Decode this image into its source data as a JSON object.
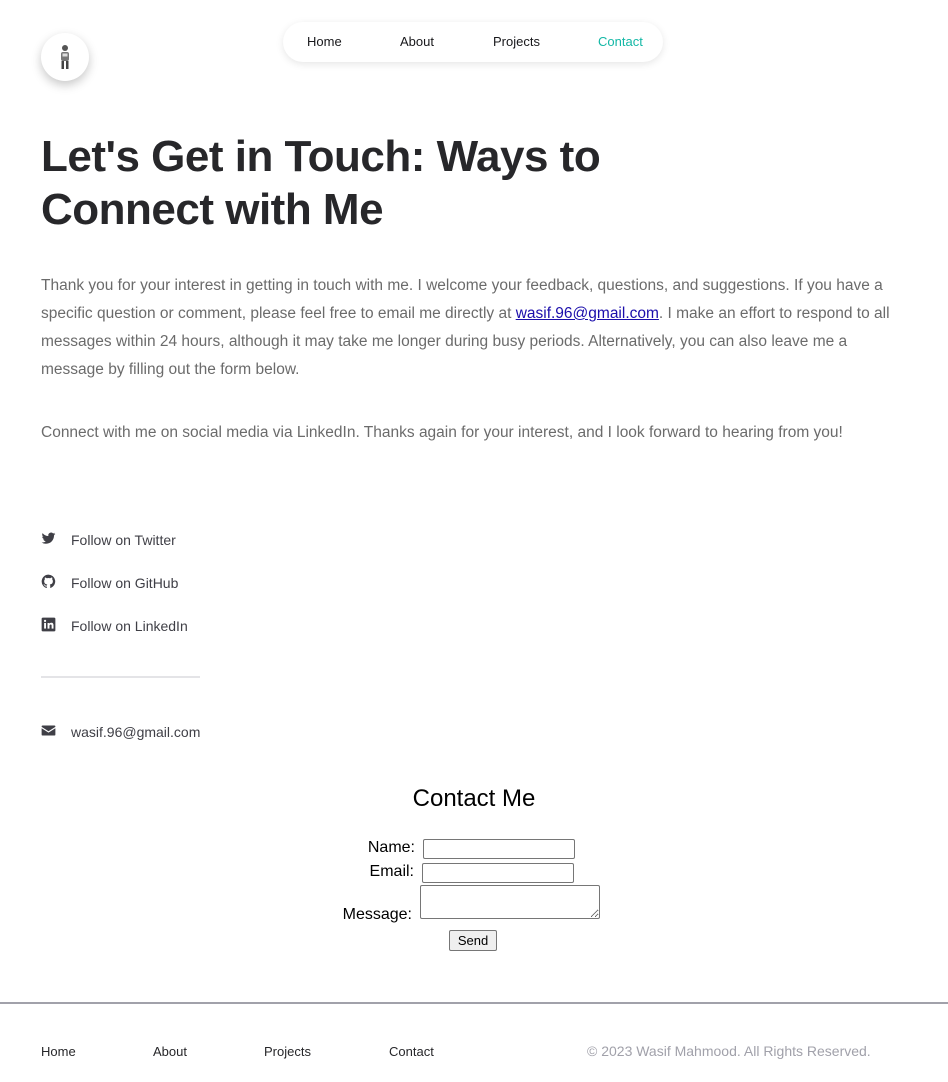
{
  "header": {
    "nav": [
      {
        "label": "Home",
        "active": false
      },
      {
        "label": "About",
        "active": false
      },
      {
        "label": "Projects",
        "active": false
      },
      {
        "label": "Contact",
        "active": true
      }
    ],
    "accent_color": "#14b8a6"
  },
  "main": {
    "title": "Let's Get in Touch: Ways to Connect with Me",
    "intro": {
      "before_email": "Thank you for your interest in getting in touch with me. I welcome your feedback, questions, and suggestions. If you have a specific question or comment, please feel free to email me directly at ",
      "email_link": "wasif.96@gmail.com",
      "after_email": ". I make an effort to respond to all messages within 24 hours, although it may take me longer during busy periods. Alternatively, you can also leave me a message by filling out the form below."
    },
    "social_note": "Connect with me on social media via LinkedIn. Thanks again for your interest, and I look forward to hearing from you!",
    "social_links": [
      {
        "icon": "twitter-icon",
        "label": "Follow on Twitter"
      },
      {
        "icon": "github-icon",
        "label": "Follow on GitHub"
      },
      {
        "icon": "linkedin-icon",
        "label": "Follow on LinkedIn"
      }
    ],
    "email": {
      "icon": "envelope-icon",
      "label": "wasif.96@gmail.com"
    }
  },
  "form": {
    "title": "Contact Me",
    "name_label": "Name:",
    "email_label": "Email:",
    "message_label": "Message:",
    "name_value": "",
    "email_value": "",
    "message_value": "",
    "send_label": "Send"
  },
  "footer": {
    "links": [
      "Home",
      "About",
      "Projects",
      "Contact"
    ],
    "copyright": "© 2023 Wasif Mahmood. All Rights Reserved."
  }
}
